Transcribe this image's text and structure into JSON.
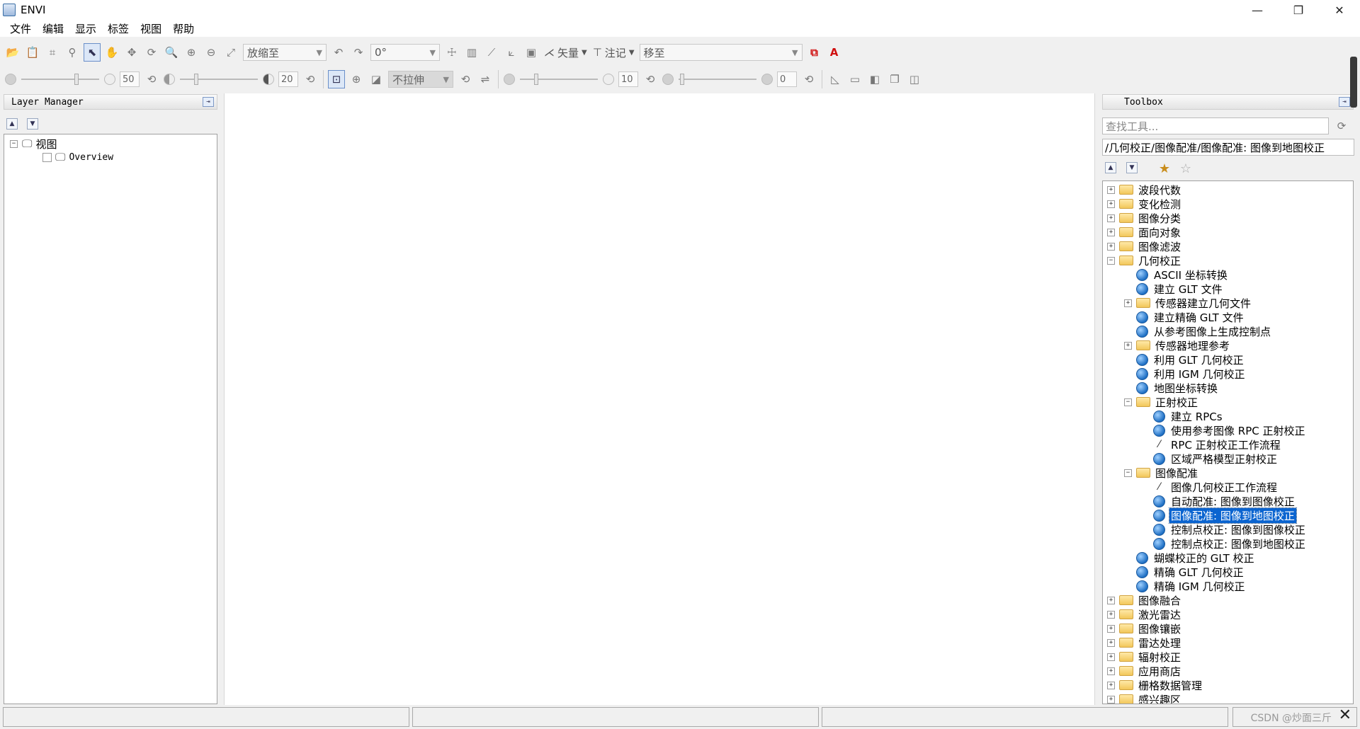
{
  "window": {
    "title": "ENVI",
    "minimize": "—",
    "restore": "❐",
    "close": "✕"
  },
  "menu": [
    "文件",
    "编辑",
    "显示",
    "标签",
    "视图",
    "帮助"
  ],
  "toolbar1": {
    "zoom_combo": "放缩至",
    "rotate_combo": "0°",
    "vector_label": "矢量",
    "annotation_label": "注记",
    "goto_combo": "移至"
  },
  "toolbar2": {
    "brightness_value": "50",
    "contrast_value": "20",
    "stretch_combo": "不拉伸",
    "sharpen_value": "10",
    "transparency_value": "0"
  },
  "layer_manager": {
    "title": "Layer Manager",
    "root": "视图",
    "child": "Overview"
  },
  "toolbox": {
    "title": "Toolbox",
    "search_placeholder": "查找工具...",
    "path": "/几何校正/图像配准/图像配准: 图像到地图校正",
    "nodes": [
      {
        "label": "波段代数"
      },
      {
        "label": "变化检测"
      },
      {
        "label": "图像分类"
      },
      {
        "label": "面向对象"
      },
      {
        "label": "图像滤波"
      },
      {
        "label": "几何校正"
      },
      {
        "label": "ASCII 坐标转换"
      },
      {
        "label": "建立 GLT 文件"
      },
      {
        "label": "传感器建立几何文件"
      },
      {
        "label": "建立精确 GLT 文件"
      },
      {
        "label": "从参考图像上生成控制点"
      },
      {
        "label": "传感器地理参考"
      },
      {
        "label": "利用 GLT 几何校正"
      },
      {
        "label": "利用 IGM 几何校正"
      },
      {
        "label": "地图坐标转换"
      },
      {
        "label": "正射校正"
      },
      {
        "label": "建立 RPCs"
      },
      {
        "label": "使用参考图像 RPC 正射校正"
      },
      {
        "label": "RPC 正射校正工作流程"
      },
      {
        "label": "区域严格模型正射校正"
      },
      {
        "label": "图像配准"
      },
      {
        "label": "图像几何校正工作流程"
      },
      {
        "label": "自动配准: 图像到图像校正"
      },
      {
        "label": "图像配准: 图像到地图校正"
      },
      {
        "label": "控制点校正: 图像到图像校正"
      },
      {
        "label": "控制点校正: 图像到地图校正"
      },
      {
        "label": "蝴蝶校正的 GLT 校正"
      },
      {
        "label": "精确 GLT 几何校正"
      },
      {
        "label": "精确 IGM 几何校正"
      },
      {
        "label": "图像融合"
      },
      {
        "label": "激光雷达"
      },
      {
        "label": "图像镶嵌"
      },
      {
        "label": "雷达处理"
      },
      {
        "label": "辐射校正"
      },
      {
        "label": "应用商店"
      },
      {
        "label": "栅格数据管理"
      },
      {
        "label": "感兴趣区"
      }
    ]
  },
  "status": {
    "watermark": "CSDN @炒面三斤"
  }
}
